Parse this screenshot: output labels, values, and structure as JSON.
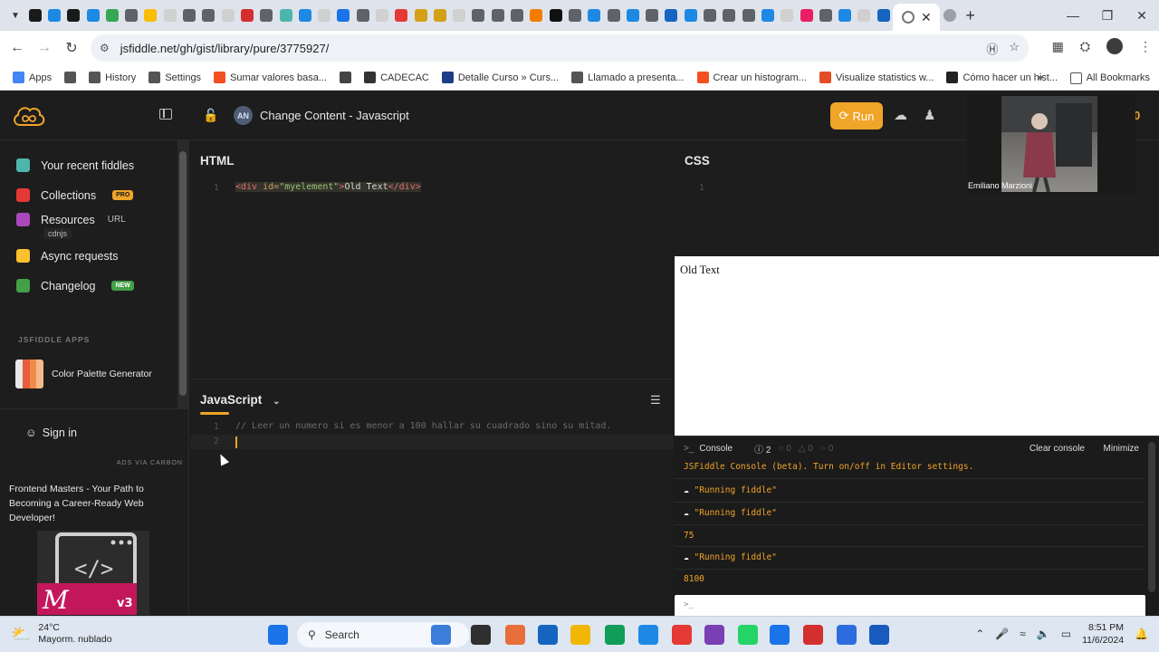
{
  "browser": {
    "tab_count_icons": 52,
    "url": "jsfiddle.net/gh/gist/library/pure/3775927/",
    "bookmarks": [
      {
        "label": "Apps",
        "color": "#4285f4"
      },
      {
        "label": "",
        "color": "#555555"
      },
      {
        "label": "History",
        "color": "#555555"
      },
      {
        "label": "Settings",
        "color": "#555555"
      },
      {
        "label": "Sumar valores basa...",
        "color": "#f25022"
      },
      {
        "label": "",
        "color": "#444444"
      },
      {
        "label": "CADECAC",
        "color": "#333333"
      },
      {
        "label": "Detalle Curso » Curs...",
        "color": "#1f3c88"
      },
      {
        "label": "Llamado a presenta...",
        "color": "#555555"
      },
      {
        "label": "Crear un histogram...",
        "color": "#f25022"
      },
      {
        "label": "Visualize statistics w...",
        "color": "#e34c26"
      },
      {
        "label": "Cómo hacer un hist...",
        "color": "#222222"
      }
    ],
    "all_bookmarks": "All Bookmarks"
  },
  "app": {
    "fiddle_avatar": "AN",
    "fiddle_title": "Change Content - Javascript",
    "run_label": "Run",
    "counter": "0"
  },
  "sidebar": {
    "items": [
      {
        "label": "Your recent fiddles",
        "icon": "grid-icon",
        "color": "#4db6ac"
      },
      {
        "label": "Collections",
        "badge": "PRO",
        "icon": "collections-icon",
        "color": "#e53935"
      },
      {
        "label": "Resources",
        "extra": "URL",
        "sub": "cdnjs",
        "icon": "resources-icon",
        "color": "#ab47bc"
      },
      {
        "label": "Async requests",
        "icon": "async-icon",
        "color": "#fbc02d"
      },
      {
        "label": "Changelog",
        "badge": "NEW",
        "icon": "changelog-icon",
        "color": "#43a047"
      }
    ],
    "apps_title": "JSFIDDLE APPS",
    "app_palette": "Color Palette Generator",
    "sign_in": "Sign in",
    "ads_via": "ADS VIA CARBON",
    "ad_text": "Frontend Masters - Your Path to Becoming a Career-Ready Web Developer!"
  },
  "editors": {
    "html": {
      "title": "HTML",
      "line": "1"
    },
    "css": {
      "title": "CSS",
      "line": "1"
    },
    "js": {
      "title": "JavaScript",
      "line1": "1",
      "line2": "2",
      "comment": "// Leer un numero si es menor a 100 hallar su cuadrado sino su mitad."
    }
  },
  "result": {
    "text": "Old Text"
  },
  "console": {
    "title": "Console",
    "error_count": "2",
    "warn_count": "0",
    "info_count": "0",
    "log_count": "0",
    "clear": "Clear console",
    "minimize": "Minimize",
    "beta_msg": "JSFiddle Console (beta). Turn on/off in Editor settings.",
    "logs": [
      "\"Running fiddle\"",
      "\"Running fiddle\"",
      "75",
      "\"Running fiddle\"",
      "8100"
    ],
    "prompt": ">_"
  },
  "webcam": {
    "name": "Emiliano Marzioni"
  },
  "taskbar": {
    "temperature": "24°C",
    "weather": "Mayorm. nublado",
    "search": "Search",
    "time": "8:51 PM",
    "date": "11/6/2024"
  }
}
